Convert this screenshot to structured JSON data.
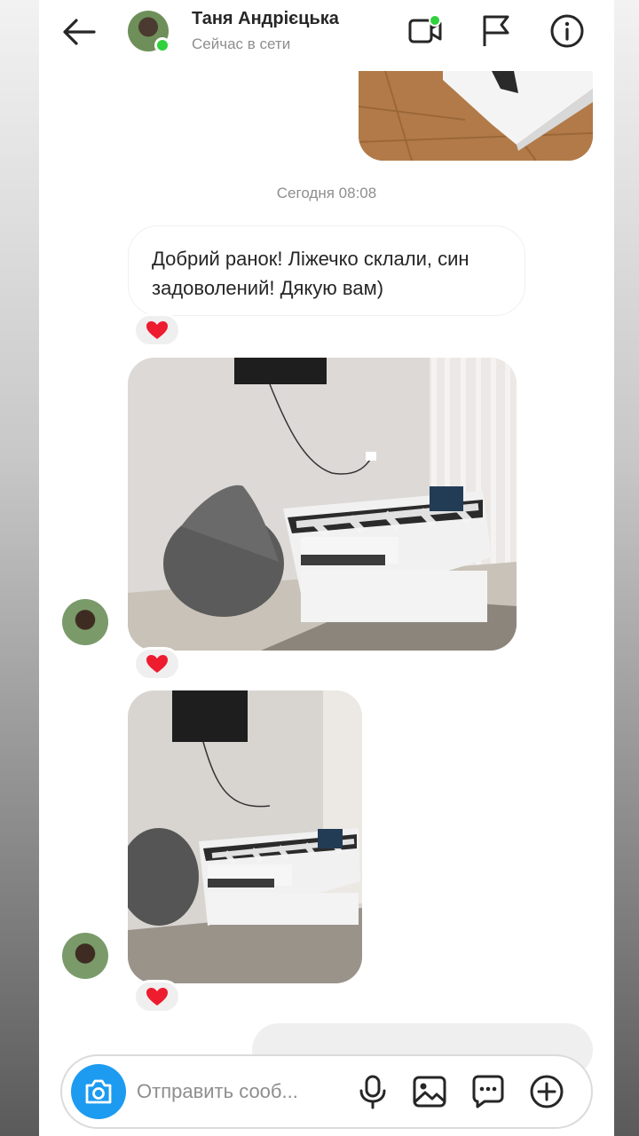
{
  "header": {
    "contact_name": "Таня Андрієцька",
    "status": "Сейчас в сети",
    "back_icon": "arrow-left-icon",
    "video_icon": "video-call-icon",
    "flag_icon": "flag-icon",
    "info_icon": "info-icon"
  },
  "thread": {
    "timestamp": "Сегодня 08:08",
    "message_text": "Добрий ранок! Ліжечко склали, син задоволений! Дякую вам)",
    "reaction": "❤️"
  },
  "composer": {
    "placeholder": "Отправить сооб..."
  },
  "colors": {
    "online": "#2fd23c",
    "accent": "#1d9bf0",
    "heart": "#ed1c2e"
  }
}
